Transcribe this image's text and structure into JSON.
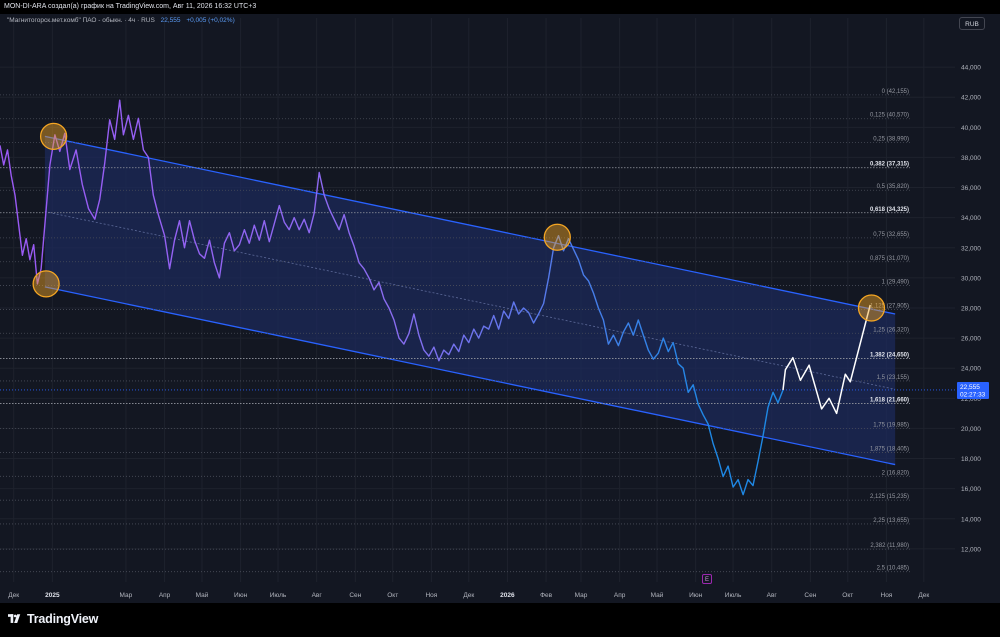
{
  "header": {
    "attribution": "MON-DI-ARA создал(а) график на TradingView.com, Авг 11, 2026 16:32 UTC+3"
  },
  "legend": {
    "symbol": "\"Магнитогорск.мет.комб\" ПАО - обыкн. · 4ч · RUS",
    "price": "22,555",
    "change": "+0,005 (+0,02%)"
  },
  "currency_button": "RUB",
  "price_tag": {
    "price": "22,555",
    "countdown": "02:27:33"
  },
  "earnings_marker": "E",
  "brand": {
    "name": "TradingView",
    "logo_icon": "tradingview-logo-icon"
  },
  "colors": {
    "background": "#131722",
    "channel_line": "#2962ff",
    "channel_fill": "#1c2a5a",
    "price_start": "#9b59f5",
    "price_end": "#1e88e5",
    "projection": "#ffffff",
    "marker": "#f5a623",
    "current_price": "#2962ff"
  },
  "chart_data": {
    "type": "line",
    "title": "\"Магнитогорск.мет.комб\" ПАО - обыкн. · 4ч · RUS",
    "xlabel": "",
    "ylabel": "",
    "grid": true,
    "y_axis": {
      "range": [
        9.8,
        45.6
      ],
      "ticks": [
        "44,000",
        "42,000",
        "40,000",
        "38,000",
        "36,000",
        "34,000",
        "32,000",
        "30,000",
        "28,000",
        "26,000",
        "24,000",
        "22,000",
        "20,000",
        "18,000",
        "16,000",
        "14,000",
        "12,000"
      ],
      "tick_values": [
        44,
        42,
        40,
        38,
        36,
        34,
        32,
        30,
        28,
        26,
        24,
        22,
        20,
        18,
        16,
        14,
        12
      ]
    },
    "x_axis": {
      "range": [
        "2024-11-20",
        "2026-12-26"
      ],
      "ticks": [
        {
          "label": "Дек",
          "date": "2024-12-01"
        },
        {
          "label": "2025",
          "date": "2025-01-01"
        },
        {
          "label": "Мар",
          "date": "2025-03-01"
        },
        {
          "label": "Апр",
          "date": "2025-04-01"
        },
        {
          "label": "Май",
          "date": "2025-05-01"
        },
        {
          "label": "Июн",
          "date": "2025-06-01"
        },
        {
          "label": "Июль",
          "date": "2025-07-01"
        },
        {
          "label": "Авг",
          "date": "2025-08-01"
        },
        {
          "label": "Сен",
          "date": "2025-09-01"
        },
        {
          "label": "Окт",
          "date": "2025-10-01"
        },
        {
          "label": "Ноя",
          "date": "2025-11-01"
        },
        {
          "label": "Дек",
          "date": "2025-12-01"
        },
        {
          "label": "2026",
          "date": "2026-01-01"
        },
        {
          "label": "Фев",
          "date": "2026-02-01"
        },
        {
          "label": "Мар",
          "date": "2026-03-01"
        },
        {
          "label": "Апр",
          "date": "2026-04-01"
        },
        {
          "label": "Май",
          "date": "2026-05-01"
        },
        {
          "label": "Июн",
          "date": "2026-06-01"
        },
        {
          "label": "Июль",
          "date": "2026-07-01"
        },
        {
          "label": "Авг",
          "date": "2026-08-01"
        },
        {
          "label": "Сен",
          "date": "2026-09-01"
        },
        {
          "label": "Окт",
          "date": "2026-10-01"
        },
        {
          "label": "Ноя",
          "date": "2026-11-01"
        },
        {
          "label": "Дек",
          "date": "2026-12-01"
        }
      ]
    },
    "series": [
      {
        "type": "line",
        "points": [
          [
            "2024-11-20",
            38.8
          ],
          [
            "2024-11-23",
            37.5
          ],
          [
            "2024-11-26",
            38.5
          ],
          [
            "2024-11-29",
            36.8
          ],
          [
            "2024-12-02",
            35.5
          ],
          [
            "2024-12-05",
            33.5
          ],
          [
            "2024-12-08",
            31.5
          ],
          [
            "2024-12-11",
            32.6
          ],
          [
            "2024-12-14",
            31.2
          ],
          [
            "2024-12-17",
            32.2
          ],
          [
            "2024-12-20",
            29.6
          ],
          [
            "2024-12-23",
            30.6
          ],
          [
            "2024-12-27",
            34.5
          ],
          [
            "2024-12-30",
            37.5
          ],
          [
            "2025-01-03",
            39.5
          ],
          [
            "2025-01-07",
            38.4
          ],
          [
            "2025-01-11",
            39.6
          ],
          [
            "2025-01-15",
            37.2
          ],
          [
            "2025-01-20",
            38.5
          ],
          [
            "2025-01-25",
            36.2
          ],
          [
            "2025-01-30",
            34.6
          ],
          [
            "2025-02-04",
            33.9
          ],
          [
            "2025-02-08",
            35.2
          ],
          [
            "2025-02-12",
            37.6
          ],
          [
            "2025-02-16",
            40.5
          ],
          [
            "2025-02-20",
            39.2
          ],
          [
            "2025-02-24",
            41.8
          ],
          [
            "2025-02-27",
            39.5
          ],
          [
            "2025-03-03",
            40.8
          ],
          [
            "2025-03-07",
            39.2
          ],
          [
            "2025-03-11",
            40.6
          ],
          [
            "2025-03-15",
            38.5
          ],
          [
            "2025-03-19",
            38.0
          ],
          [
            "2025-03-23",
            35.5
          ],
          [
            "2025-03-27",
            34.2
          ],
          [
            "2025-04-01",
            32.8
          ],
          [
            "2025-04-05",
            30.6
          ],
          [
            "2025-04-09",
            32.5
          ],
          [
            "2025-04-13",
            33.8
          ],
          [
            "2025-04-17",
            32.0
          ],
          [
            "2025-04-21",
            33.8
          ],
          [
            "2025-04-25",
            32.5
          ],
          [
            "2025-04-29",
            31.6
          ],
          [
            "2025-05-03",
            31.3
          ],
          [
            "2025-05-07",
            32.5
          ],
          [
            "2025-05-11",
            31.0
          ],
          [
            "2025-05-15",
            30.0
          ],
          [
            "2025-05-19",
            32.3
          ],
          [
            "2025-05-23",
            33.0
          ],
          [
            "2025-05-27",
            31.8
          ],
          [
            "2025-05-31",
            32.2
          ],
          [
            "2025-06-04",
            33.2
          ],
          [
            "2025-06-08",
            32.3
          ],
          [
            "2025-06-12",
            33.5
          ],
          [
            "2025-06-16",
            32.5
          ],
          [
            "2025-06-20",
            33.8
          ],
          [
            "2025-06-24",
            32.4
          ],
          [
            "2025-06-28",
            33.6
          ],
          [
            "2025-07-02",
            34.8
          ],
          [
            "2025-07-06",
            33.7
          ],
          [
            "2025-07-10",
            33.2
          ],
          [
            "2025-07-14",
            34.0
          ],
          [
            "2025-07-18",
            33.2
          ],
          [
            "2025-07-22",
            33.9
          ],
          [
            "2025-07-26",
            33.0
          ],
          [
            "2025-07-30",
            34.3
          ],
          [
            "2025-08-03",
            37.0
          ],
          [
            "2025-08-07",
            35.5
          ],
          [
            "2025-08-11",
            34.6
          ],
          [
            "2025-08-15",
            33.9
          ],
          [
            "2025-08-19",
            33.2
          ],
          [
            "2025-08-23",
            34.2
          ],
          [
            "2025-08-27",
            33.0
          ],
          [
            "2025-08-31",
            32.1
          ],
          [
            "2025-09-04",
            31.0
          ],
          [
            "2025-09-08",
            30.6
          ],
          [
            "2025-09-12",
            30.0
          ],
          [
            "2025-09-16",
            29.2
          ],
          [
            "2025-09-20",
            29.7
          ],
          [
            "2025-09-24",
            28.6
          ],
          [
            "2025-09-28",
            28.0
          ],
          [
            "2025-10-02",
            27.2
          ],
          [
            "2025-10-06",
            26.0
          ],
          [
            "2025-10-10",
            25.6
          ],
          [
            "2025-10-14",
            26.3
          ],
          [
            "2025-10-18",
            27.6
          ],
          [
            "2025-10-22",
            26.2
          ],
          [
            "2025-10-26",
            25.2
          ],
          [
            "2025-10-30",
            24.8
          ],
          [
            "2025-11-03",
            25.4
          ],
          [
            "2025-11-07",
            24.5
          ],
          [
            "2025-11-11",
            25.2
          ],
          [
            "2025-11-15",
            24.9
          ],
          [
            "2025-11-19",
            25.6
          ],
          [
            "2025-11-23",
            25.1
          ],
          [
            "2025-11-27",
            26.2
          ],
          [
            "2025-12-01",
            25.7
          ],
          [
            "2025-12-05",
            26.6
          ],
          [
            "2025-12-09",
            26.0
          ],
          [
            "2025-12-13",
            26.8
          ],
          [
            "2025-12-17",
            26.6
          ],
          [
            "2025-12-21",
            27.5
          ],
          [
            "2025-12-25",
            26.6
          ],
          [
            "2025-12-29",
            27.8
          ],
          [
            "2026-01-02",
            27.3
          ],
          [
            "2026-01-06",
            28.4
          ],
          [
            "2026-01-10",
            27.6
          ],
          [
            "2026-01-14",
            28.0
          ],
          [
            "2026-01-18",
            27.7
          ],
          [
            "2026-01-22",
            27.0
          ],
          [
            "2026-01-26",
            27.6
          ],
          [
            "2026-01-30",
            28.3
          ],
          [
            "2026-02-03",
            30.0
          ],
          [
            "2026-02-07",
            32.0
          ],
          [
            "2026-02-11",
            32.8
          ],
          [
            "2026-02-15",
            31.8
          ],
          [
            "2026-02-19",
            32.6
          ],
          [
            "2026-02-23",
            31.9
          ],
          [
            "2026-02-27",
            31.2
          ],
          [
            "2026-03-03",
            30.2
          ],
          [
            "2026-03-07",
            29.8
          ],
          [
            "2026-03-11",
            29.0
          ],
          [
            "2026-03-15",
            28.0
          ],
          [
            "2026-03-19",
            27.2
          ],
          [
            "2026-03-23",
            25.6
          ],
          [
            "2026-03-27",
            26.2
          ],
          [
            "2026-03-31",
            25.5
          ],
          [
            "2026-04-04",
            26.4
          ],
          [
            "2026-04-08",
            27.0
          ],
          [
            "2026-04-12",
            26.2
          ],
          [
            "2026-04-16",
            27.2
          ],
          [
            "2026-04-20",
            26.2
          ],
          [
            "2026-04-24",
            25.2
          ],
          [
            "2026-04-28",
            24.6
          ],
          [
            "2026-05-02",
            25.0
          ],
          [
            "2026-05-06",
            26.0
          ],
          [
            "2026-05-10",
            25.1
          ],
          [
            "2026-05-14",
            25.7
          ],
          [
            "2026-05-18",
            24.3
          ],
          [
            "2026-05-22",
            24.0
          ],
          [
            "2026-05-26",
            22.4
          ],
          [
            "2026-05-30",
            22.9
          ],
          [
            "2026-06-03",
            21.6
          ],
          [
            "2026-06-07",
            20.9
          ],
          [
            "2026-06-11",
            20.3
          ],
          [
            "2026-06-15",
            19.0
          ],
          [
            "2026-06-19",
            18.0
          ],
          [
            "2026-06-23",
            16.8
          ],
          [
            "2026-06-27",
            17.5
          ],
          [
            "2026-07-01",
            16.1
          ],
          [
            "2026-07-05",
            16.6
          ],
          [
            "2026-07-09",
            15.6
          ],
          [
            "2026-07-13",
            16.6
          ],
          [
            "2026-07-17",
            16.2
          ],
          [
            "2026-07-21",
            17.8
          ],
          [
            "2026-07-25",
            19.5
          ],
          [
            "2026-07-29",
            21.4
          ],
          [
            "2026-08-02",
            22.4
          ],
          [
            "2026-08-06",
            21.7
          ],
          [
            "2026-08-10",
            22.555
          ]
        ]
      },
      {
        "type": "projection",
        "points": [
          [
            "2026-08-12",
            23.9
          ],
          [
            "2026-08-18",
            24.7
          ],
          [
            "2026-08-24",
            23.2
          ],
          [
            "2026-08-31",
            24.2
          ],
          [
            "2026-09-10",
            21.3
          ],
          [
            "2026-09-16",
            22.0
          ],
          [
            "2026-09-22",
            21.0
          ],
          [
            "2026-09-29",
            23.6
          ],
          [
            "2026-10-03",
            23.1
          ],
          [
            "2026-10-19",
            28.2
          ]
        ]
      }
    ],
    "regression_channel": {
      "upper": [
        [
          "2024-12-26",
          39.4
        ],
        [
          "2026-11-08",
          27.6
        ]
      ],
      "lower": [
        [
          "2024-12-26",
          29.4
        ],
        [
          "2026-11-08",
          17.6
        ]
      ],
      "median": [
        [
          "2024-12-26",
          34.4
        ],
        [
          "2026-11-08",
          22.6
        ]
      ]
    },
    "circled_points": [
      [
        "2024-12-27",
        29.6
      ],
      [
        "2025-01-02",
        39.4
      ],
      [
        "2026-02-10",
        32.7
      ],
      [
        "2026-10-20",
        28.0
      ]
    ],
    "fibonacci_levels": [
      {
        "label": "0 (42,155)",
        "ratio": 0,
        "price": 42.155,
        "bold": false
      },
      {
        "label": "0,125 (40,570)",
        "ratio": 0.125,
        "price": 40.57,
        "bold": false
      },
      {
        "label": "0,25 (38,990)",
        "ratio": 0.25,
        "price": 38.99,
        "bold": false
      },
      {
        "label": "0,382 (37,315)",
        "ratio": 0.382,
        "price": 37.315,
        "bold": true
      },
      {
        "label": "0,5 (35,820)",
        "ratio": 0.5,
        "price": 35.82,
        "bold": false
      },
      {
        "label": "0,618 (34,325)",
        "ratio": 0.618,
        "price": 34.325,
        "bold": true
      },
      {
        "label": "0,75 (32,655)",
        "ratio": 0.75,
        "price": 32.655,
        "bold": false
      },
      {
        "label": "0,875 (31,070)",
        "ratio": 0.875,
        "price": 31.07,
        "bold": false
      },
      {
        "label": "1 (29,490)",
        "ratio": 1,
        "price": 29.49,
        "bold": false
      },
      {
        "label": "1,125 (27,905)",
        "ratio": 1.125,
        "price": 27.905,
        "bold": false
      },
      {
        "label": "1,25 (26,320)",
        "ratio": 1.25,
        "price": 26.32,
        "bold": false
      },
      {
        "label": "1,382 (24,650)",
        "ratio": 1.382,
        "price": 24.65,
        "bold": true
      },
      {
        "label": "1,5 (23,155)",
        "ratio": 1.5,
        "price": 23.155,
        "bold": false
      },
      {
        "label": "1,618 (21,660)",
        "ratio": 1.618,
        "price": 21.66,
        "bold": true
      },
      {
        "label": "1,75 (19,985)",
        "ratio": 1.75,
        "price": 19.985,
        "bold": false
      },
      {
        "label": "1,875 (18,405)",
        "ratio": 1.875,
        "price": 18.405,
        "bold": false
      },
      {
        "label": "2 (16,820)",
        "ratio": 2,
        "price": 16.82,
        "bold": false
      },
      {
        "label": "2,125 (15,235)",
        "ratio": 2.125,
        "price": 15.235,
        "bold": false
      },
      {
        "label": "2,25 (13,655)",
        "ratio": 2.25,
        "price": 13.655,
        "bold": false
      },
      {
        "label": "2,382 (11,980)",
        "ratio": 2.382,
        "price": 11.98,
        "bold": false
      },
      {
        "label": "2,5 (10,485)",
        "ratio": 2.5,
        "price": 10.485,
        "bold": false
      }
    ],
    "last_price": 22.555
  }
}
